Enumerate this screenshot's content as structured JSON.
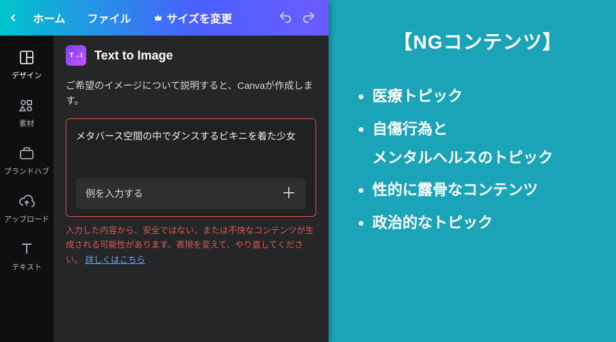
{
  "topbar": {
    "home": "ホーム",
    "file": "ファイル",
    "resize": "サイズを変更"
  },
  "sidenav": {
    "items": [
      {
        "label": "デザイン"
      },
      {
        "label": "素材"
      },
      {
        "label": "ブランドハブ"
      },
      {
        "label": "アップロード"
      },
      {
        "label": "テキスト"
      }
    ]
  },
  "feature": {
    "title": "Text to Image",
    "description": "ご希望のイメージについて説明すると、Canvaが作成します。",
    "prompt_value": "メタバース空間の中でダンスするビキニを着た少女",
    "example_label": "例を入力する",
    "error_message_1": "入力した内容から、安全ではない、または不快なコンテンツが生成される可能性があります。表現を変えて、やり直してください。",
    "error_link": "詳しくはこちら"
  },
  "info": {
    "heading": "【NGコンテンツ】",
    "bullets": [
      "医療トピック",
      "自傷行為と",
      "メンタルヘルスのトピック",
      "性的に露骨なコンテンツ",
      "政治的なトピック"
    ]
  }
}
